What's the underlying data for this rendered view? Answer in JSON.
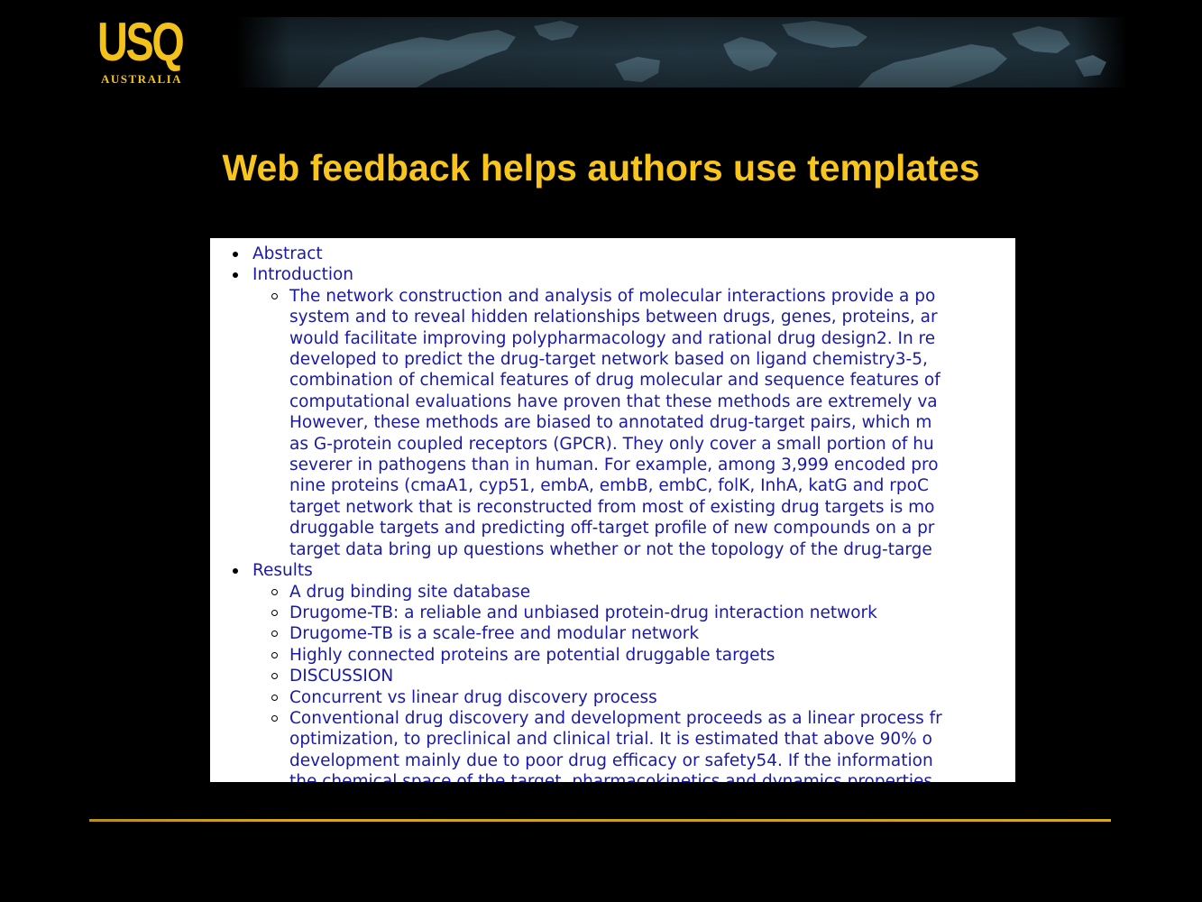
{
  "logo": {
    "main": "USQ",
    "sub": "AUSTRALIA"
  },
  "colors": {
    "background": "#000000",
    "title": "#f7c51c",
    "link": "#1a1aa6",
    "rule": "#d4a51a"
  },
  "slide": {
    "title": "Web feedback helps authors use templates"
  },
  "screenshot": {
    "sections": [
      {
        "label": "Abstract",
        "items": []
      },
      {
        "label": "Introduction",
        "items": [
          {
            "lines": [
              "The network construction and analysis of molecular interactions provide a po",
              "system and to reveal hidden relationships between drugs, genes, proteins, ar",
              "would facilitate improving polypharmacology and rational drug design2. In re",
              "developed to predict the drug-target network based on ligand chemistry3-5, ",
              "combination of chemical features of drug molecular and sequence features of",
              "computational evaluations have proven that these methods are extremely va",
              "However, these methods are biased to annotated drug-target pairs, which m",
              "as G-protein coupled receptors (GPCR). They only cover a small portion of hu",
              "severer in pathogens than in human. For example, among 3,999 encoded pro",
              "nine proteins (cmaA1, cyp51, embA, embB, embC, folK, InhA, katG and rpoC",
              "target network that is reconstructed from most of existing drug targets is mo",
              "druggable targets and predicting off-target profile of new compounds on a pr",
              "target data bring up questions whether or not the topology of the drug-targe"
            ]
          }
        ]
      },
      {
        "label": "Results",
        "items": [
          {
            "lines": [
              "A drug binding site database"
            ]
          },
          {
            "lines": [
              "Drugome-TB: a reliable and unbiased protein-drug interaction network"
            ]
          },
          {
            "lines": [
              "Drugome-TB is a scale-free and modular network"
            ]
          },
          {
            "lines": [
              "Highly connected proteins are potential druggable targets"
            ]
          },
          {
            "lines": [
              "DISCUSSION"
            ]
          },
          {
            "lines": [
              "Concurrent vs linear drug discovery process"
            ]
          },
          {
            "lines": [
              "Conventional drug discovery and development proceeds as a linear process fr",
              "optimization, to preclinical and clinical trial. It is estimated that above 90% o",
              "development mainly due to poor drug efficacy or safety54. If the information",
              "the chemical space of the target, pharmacokinetics and dynamics properties"
            ]
          }
        ]
      }
    ]
  }
}
